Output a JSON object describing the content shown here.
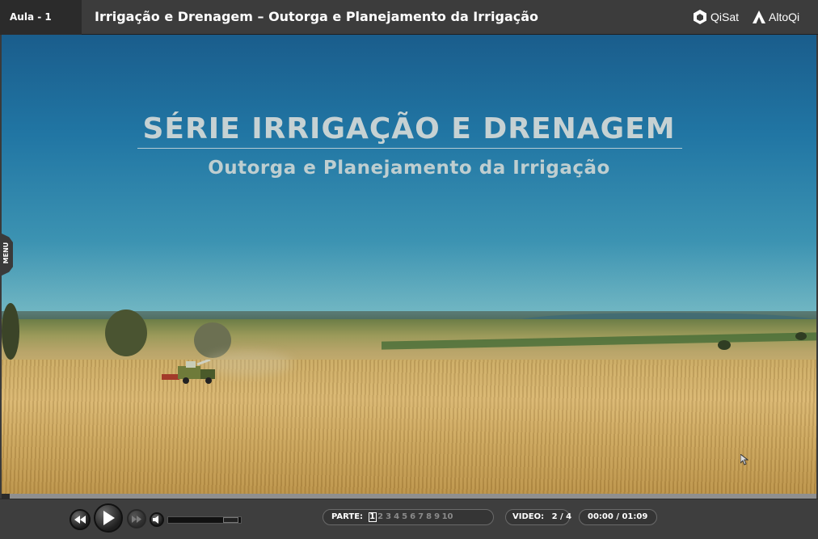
{
  "header": {
    "lesson_label": "Aula - 1",
    "title": "Irrigação e Drenagem – Outorga e Planejamento da Irrigação",
    "brands": [
      {
        "name": "QiSat",
        "icon": "qisat-logo-icon"
      },
      {
        "name": "AltoQi",
        "icon": "altoqi-logo-icon"
      }
    ]
  },
  "video": {
    "title": "SÉRIE IRRIGAÇÃO E DRENAGEM",
    "subtitle": "Outorga e Planejamento da Irrigação",
    "menu_label": "MENU"
  },
  "playback": {
    "progress_fraction": 0.01,
    "parts_label": "PARTE:",
    "parts": [
      "1",
      "2",
      "3",
      "4",
      "5",
      "6",
      "7",
      "8",
      "9",
      "10"
    ],
    "active_part": "1",
    "video_label": "VIDEO:",
    "video_counter": "2 / 4",
    "time": "00:00 / 01:09",
    "volume_fraction": 0.8
  },
  "colors": {
    "header_bg": "#3c3c3c",
    "controls_bg": "#3e3e3e",
    "sky_top": "#1a5d8c",
    "wheat": "#d8b572"
  }
}
